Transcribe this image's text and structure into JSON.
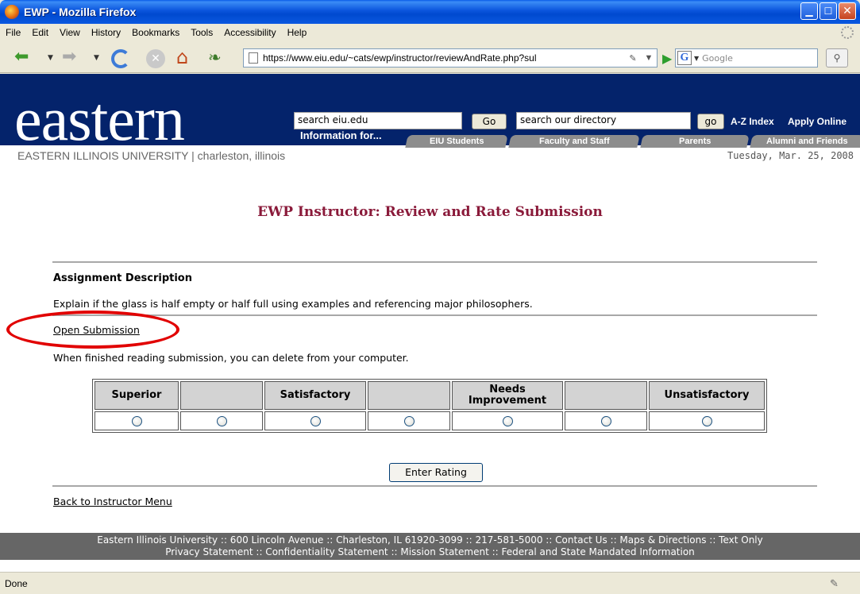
{
  "window": {
    "title": "EWP - Mozilla Firefox"
  },
  "menu": [
    "File",
    "Edit",
    "View",
    "History",
    "Bookmarks",
    "Tools",
    "Accessibility",
    "Help"
  ],
  "navbar": {
    "url": "https://www.eiu.edu/~cats/ewp/instructor/reviewAndRate.php?sul",
    "search_placeholder": "Google"
  },
  "site": {
    "logo": "eastern",
    "university_line": "EASTERN ILLINOIS UNIVERSITY | charleston, illinois",
    "date": "Tuesday, Mar. 25, 2008",
    "search_value": "search eiu.edu",
    "search_go": "Go",
    "directory_value": "search our directory",
    "directory_go": "go",
    "az_index": "A-Z Index",
    "apply_online": "Apply Online",
    "information_for": "Information for...",
    "tabs": [
      "EIU Students",
      "Faculty and Staff",
      "Parents",
      "Alumni and Friends"
    ]
  },
  "page": {
    "title": "EWP Instructor: Review and Rate Submission",
    "section_heading": "Assignment Description",
    "assignment_text": "Explain if the glass is half empty or half full using examples and referencing major philosophers.",
    "open_submission": "Open Submission",
    "after_note": "When finished reading submission, you can delete from your computer.",
    "rating_headers": [
      "Superior",
      "",
      "Satisfactory",
      "",
      "Needs Improvement",
      "",
      "Unsatisfactory"
    ],
    "rating_headers_split": {
      "needs": "Needs",
      "improvement": "Improvement"
    },
    "enter_rating": "Enter Rating",
    "back_link": "Back to Instructor Menu"
  },
  "footer": {
    "line1": "Eastern Illinois University :: 600 Lincoln Avenue :: Charleston, IL 61920-3099 :: 217-581-5000 :: Contact Us :: Maps & Directions :: Text Only",
    "line2": "Privacy Statement :: Confidentiality Statement :: Mission Statement :: Federal and State Mandated Information"
  },
  "status": {
    "text": "Done"
  },
  "colors": {
    "header_blue": "#04236b",
    "title_maroon": "#8a1a3a",
    "highlight_red": "#e10000"
  }
}
